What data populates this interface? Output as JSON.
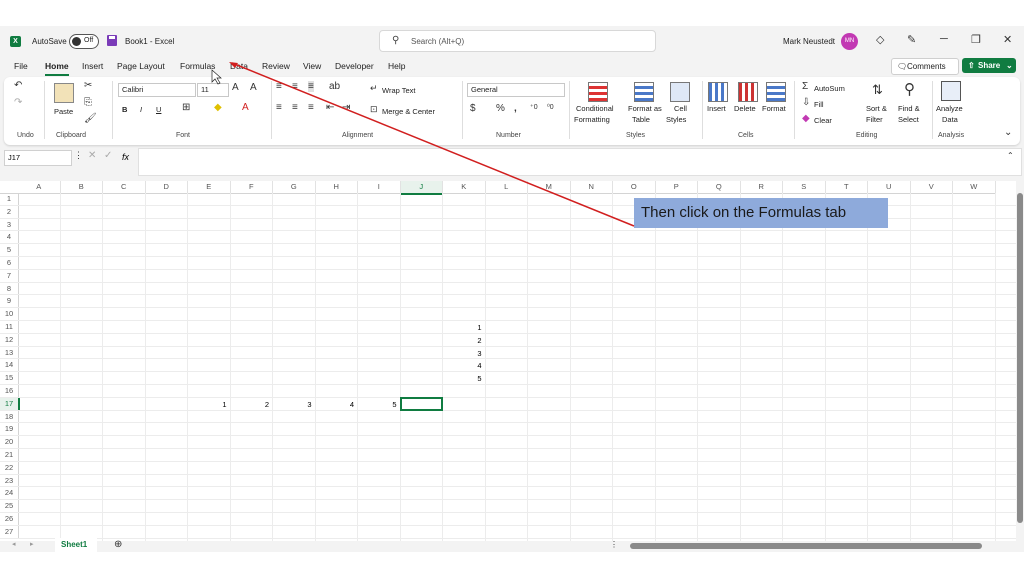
{
  "title_bar": {
    "autosave_label": "AutoSave",
    "autosave_state": "Off",
    "document_title": "Book1  -  Excel",
    "search_placeholder": "Search (Alt+Q)",
    "user_name": "Mark Neustedt",
    "user_initials": "MN"
  },
  "tabs": [
    "File",
    "Home",
    "Insert",
    "Page Layout",
    "Formulas",
    "Data",
    "Review",
    "View",
    "Developer",
    "Help"
  ],
  "active_tab": "Home",
  "comments_label": "Comments",
  "share_label": "Share",
  "ribbon": {
    "undo_label": "Undo",
    "clipboard": {
      "paste": "Paste",
      "group": "Clipboard"
    },
    "font": {
      "name": "Calibri",
      "size": "11",
      "bold": "B",
      "italic": "I",
      "underline": "U",
      "group": "Font"
    },
    "alignment": {
      "wrap_text": "Wrap Text",
      "merge_center": "Merge & Center",
      "group": "Alignment"
    },
    "number": {
      "format": "General",
      "group": "Number"
    },
    "styles": {
      "conditional_1": "Conditional",
      "conditional_2": "Formatting",
      "format_as_1": "Format as",
      "format_as_2": "Table",
      "cell_styles_1": "Cell",
      "cell_styles_2": "Styles",
      "group": "Styles"
    },
    "cells": {
      "insert": "Insert",
      "delete": "Delete",
      "format": "Format",
      "group": "Cells"
    },
    "editing": {
      "autosum": "AutoSum",
      "fill": "Fill",
      "clear": "Clear",
      "sort_1": "Sort &",
      "sort_2": "Filter",
      "find_1": "Find &",
      "find_2": "Select",
      "group": "Editing"
    },
    "analysis": {
      "analyze_1": "Analyze",
      "analyze_2": "Data",
      "group": "Analysis"
    }
  },
  "formula_bar": {
    "name_box": "J17",
    "fx": "fx",
    "content": ""
  },
  "columns": [
    "A",
    "B",
    "C",
    "D",
    "E",
    "F",
    "G",
    "H",
    "I",
    "J",
    "K",
    "L",
    "M",
    "N",
    "O",
    "P",
    "Q",
    "R",
    "S",
    "T",
    "U",
    "V",
    "W"
  ],
  "rows": [
    "1",
    "2",
    "3",
    "4",
    "5",
    "6",
    "7",
    "8",
    "9",
    "10",
    "11",
    "12",
    "13",
    "14",
    "15",
    "16",
    "17",
    "18",
    "19",
    "20",
    "21",
    "22",
    "23",
    "24",
    "25",
    "26",
    "27"
  ],
  "selected_cell": "J17",
  "cells": [
    {
      "ref": "K11",
      "value": "1"
    },
    {
      "ref": "K12",
      "value": "2"
    },
    {
      "ref": "K13",
      "value": "3"
    },
    {
      "ref": "K14",
      "value": "4"
    },
    {
      "ref": "K15",
      "value": "5"
    },
    {
      "ref": "E17",
      "value": "1"
    },
    {
      "ref": "F17",
      "value": "2"
    },
    {
      "ref": "G17",
      "value": "3"
    },
    {
      "ref": "H17",
      "value": "4"
    },
    {
      "ref": "I17",
      "value": "5"
    }
  ],
  "sheets": [
    "Sheet1"
  ],
  "active_sheet": "Sheet1",
  "callout": "Then click on the Formulas tab",
  "colors": {
    "excel_green": "#107c41",
    "callout_bg": "#8eaadb",
    "arrow": "#d11f1f"
  }
}
